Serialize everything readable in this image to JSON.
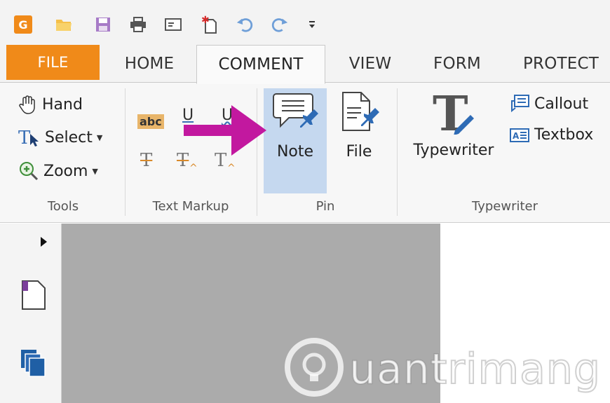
{
  "qat": {
    "icons": [
      "app-logo-icon",
      "open-folder-icon",
      "save-icon",
      "print-icon",
      "properties-icon",
      "new-icon",
      "undo-icon",
      "redo-icon",
      "customize-dropdown-icon"
    ],
    "logo_letter": "G",
    "brand_color": "#f08a19"
  },
  "tabs": [
    {
      "label": "FILE"
    },
    {
      "label": "HOME"
    },
    {
      "label": "COMMENT"
    },
    {
      "label": "VIEW"
    },
    {
      "label": "FORM"
    },
    {
      "label": "PROTECT"
    }
  ],
  "active_tab": "COMMENT",
  "ribbon": {
    "tools": {
      "label": "Tools",
      "hand": "Hand",
      "select": "Select",
      "zoom": "Zoom"
    },
    "text_markup": {
      "label": "Text Markup",
      "highlight_text": "abc",
      "underline_glyph": "U",
      "strike_glyph": "T"
    },
    "pin": {
      "label": "Pin",
      "note": "Note",
      "file": "File"
    },
    "typewriter": {
      "label": "Typewriter",
      "typewriter": "Typewriter",
      "callout": "Callout",
      "textbox": "Textbox"
    }
  },
  "annotation": {
    "arrow_color": "#c2189f"
  },
  "colors": {
    "note_highlight": "#c5d8ef",
    "canvas_gray": "#ababab",
    "pin_blue": "#2e6bb5"
  },
  "watermark": {
    "text": "uantrimang"
  }
}
